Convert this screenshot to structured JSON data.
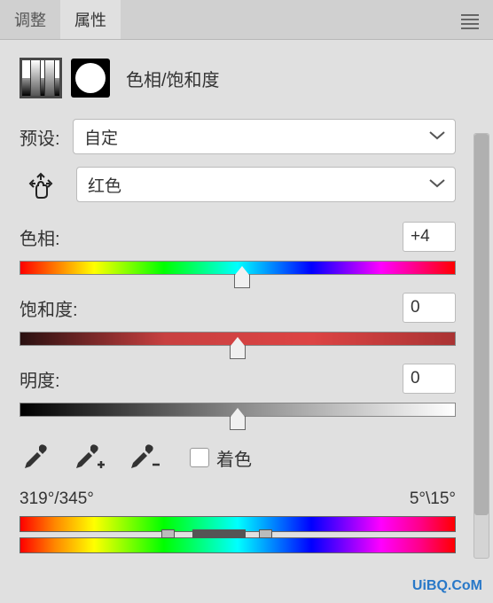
{
  "tabs": {
    "adjust": "调整",
    "properties": "属性"
  },
  "header": {
    "title": "色相/饱和度"
  },
  "preset": {
    "label": "预设:",
    "value": "自定"
  },
  "channel": {
    "value": "红色"
  },
  "sliders": {
    "hue": {
      "label": "色相:",
      "value": "+4"
    },
    "saturation": {
      "label": "饱和度:",
      "value": "0"
    },
    "lightness": {
      "label": "明度:",
      "value": "0"
    }
  },
  "colorize": {
    "label": "着色"
  },
  "range": {
    "left": "319°/345°",
    "right": "5°\\15°"
  },
  "watermark": "UiBQ.CoM",
  "watermark2": ""
}
